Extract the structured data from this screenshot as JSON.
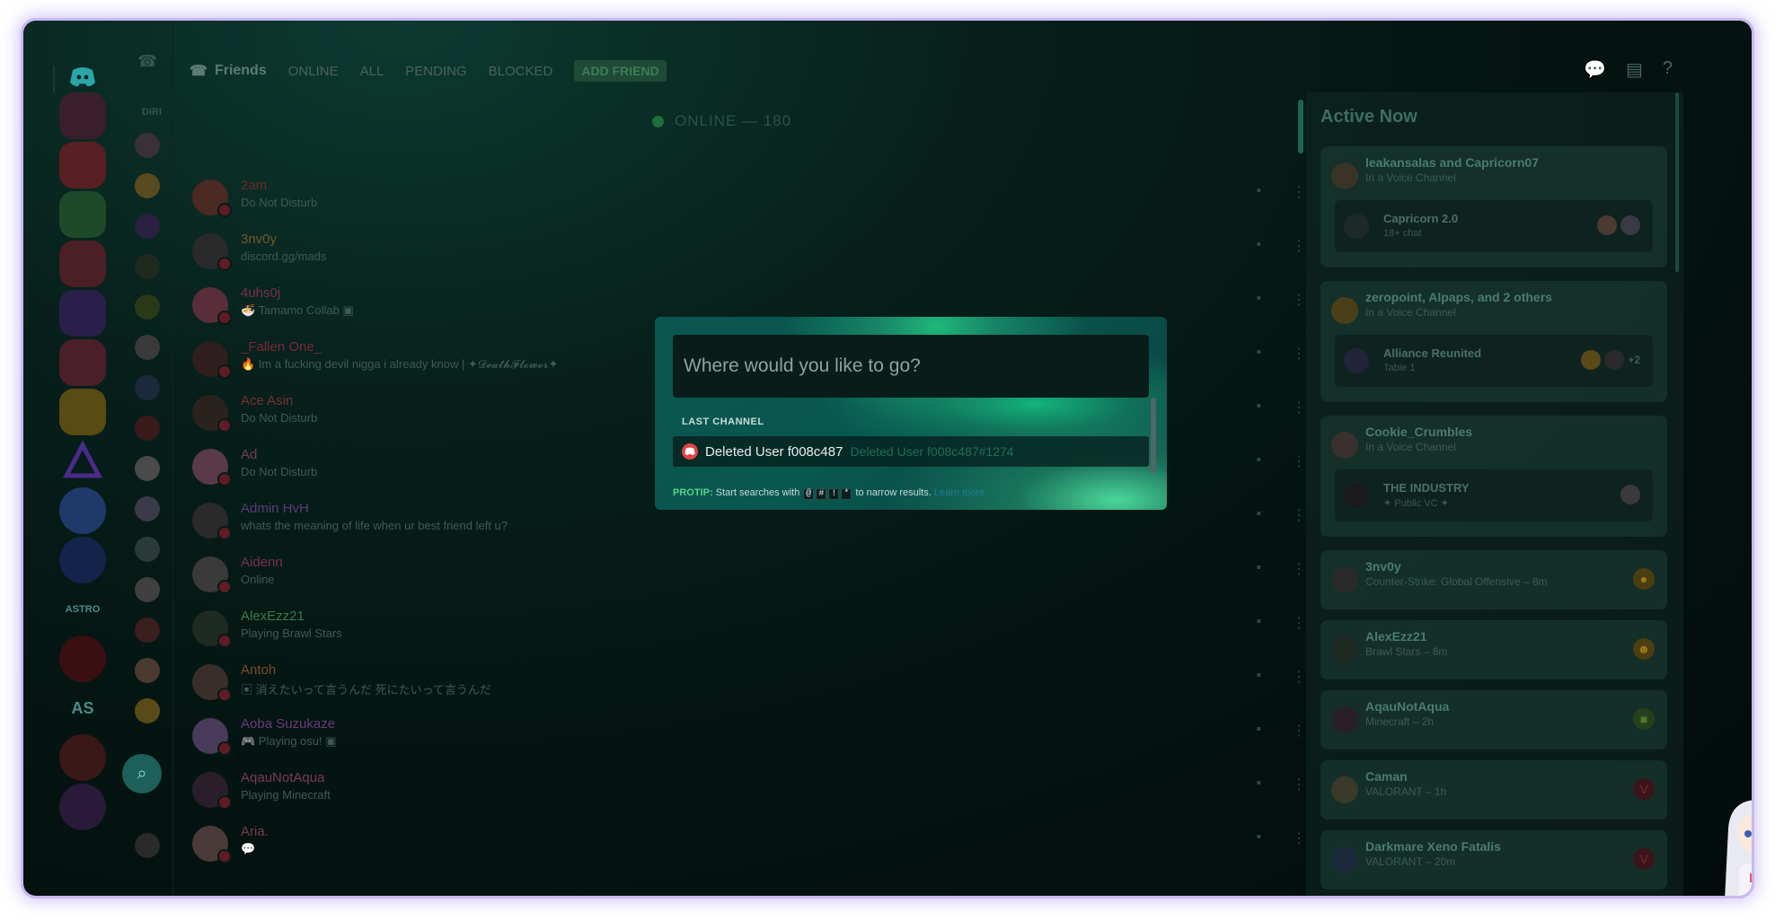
{
  "topbar": {
    "friends": "Friends",
    "tabs": [
      "ONLINE",
      "ALL",
      "PENDING",
      "BLOCKED"
    ],
    "add_friend": "ADD FRIEND"
  },
  "sidebar": {
    "dm_header": "DIRI",
    "guild_texts": [
      "ASTRO",
      "AS"
    ]
  },
  "friends": {
    "online_header": "ONLINE — 180",
    "rows": [
      {
        "name": "2am",
        "status": "Do Not Disturb",
        "color": "#6b2a2a",
        "avatar": "#4a2a22"
      },
      {
        "name": "3nv0y",
        "status": "discord.gg/mads",
        "color": "#6e5a2a",
        "avatar": "#2a2a2a"
      },
      {
        "name": "4uhs0j",
        "status": "🍜 Tamamo Collab ▣",
        "color": "#7a2f4a",
        "avatar": "#5a2d3a"
      },
      {
        "name": "_Fallen One_",
        "status": "🔥 Im a fucking devil nigga i already know | ✦𝓓𝓮𝓪𝓽𝓱𝓕𝓵𝓸𝔀𝓮𝓻✦",
        "color": "#7a2a35",
        "avatar": "#2f1e1e"
      },
      {
        "name": "Ace Asin",
        "status": "Do Not Disturb",
        "color": "#7a2f2f",
        "avatar": "#2a221e"
      },
      {
        "name": "Ad",
        "status": "Do Not Disturb",
        "color": "#7a3a5a",
        "avatar": "#5a3a48"
      },
      {
        "name": "Admin HvH",
        "status": "whats the meaning of life when ur best friend left u?",
        "color": "#5a3a7a",
        "avatar": "#2a2a2a"
      },
      {
        "name": "Aidenn",
        "status": "Online",
        "color": "#7a2f5a",
        "avatar": "#3a3a3a"
      },
      {
        "name": "AlexEzz21",
        "status": "Playing Brawl Stars",
        "color": "#3a7a4a",
        "avatar": "#1e2a22"
      },
      {
        "name": "Antoh",
        "status": "▣ 消えたいって言うんだ 死にたいって言うんだ",
        "color": "#7a4a2a",
        "avatar": "#3a2e2a"
      },
      {
        "name": "Aoba Suzukaze",
        "status": "🎮 Playing osu! ▣",
        "color": "#6a3a7a",
        "avatar": "#4a3a5a"
      },
      {
        "name": "AqauNotAqua",
        "status": "Playing Minecraft",
        "color": "#7a3a5a",
        "avatar": "#2a1e2a"
      },
      {
        "name": "Aria.",
        "status": "💬",
        "color": "#7a3a4a",
        "avatar": "#4a3a3a"
      }
    ]
  },
  "active_now": {
    "title": "Active Now",
    "cards": [
      {
        "name": "leakansalas and Capricorn07",
        "sub": "In a Voice Channel",
        "inner_name": "Capricorn 2.0",
        "inner_sub": "18+ chat",
        "extra": ""
      },
      {
        "name": "zeropoint, Alpaps, and 2 others",
        "sub": "In a Voice Channel",
        "inner_name": "Alliance Reunited",
        "inner_sub": "Table 1",
        "extra": "+2"
      },
      {
        "name": "Cookie_Crumbles",
        "sub": "In a Voice Channel",
        "inner_name": "THE INDUSTRY",
        "inner_sub": "✦ Public VC ✦",
        "extra": ""
      }
    ],
    "games": [
      {
        "name": "3nv0y",
        "sub": "Counter-Strike: Global Offensive – 8m"
      },
      {
        "name": "AlexEzz21",
        "sub": "Brawl Stars – 8m"
      },
      {
        "name": "AqauNotAqua",
        "sub": "Minecraft – 2h"
      },
      {
        "name": "Caman",
        "sub": "VALORANT – 1h"
      },
      {
        "name": "Darkmare Xeno Fatalis",
        "sub": "VALORANT – 20m"
      }
    ]
  },
  "quick_switcher": {
    "placeholder": "Where would you like to go?",
    "section": "LAST CHANNEL",
    "item_name": "Deleted User f008c487",
    "item_tag": "Deleted User f008c487#1274",
    "tip_label": "PROTIP:",
    "tip_text1": "Start searches with",
    "tip_keys": [
      "@",
      "#",
      "!",
      "*"
    ],
    "tip_text2": "to narrow results.",
    "tip_link": "Learn more"
  },
  "colors": {
    "accent": "#1fb87a",
    "danger": "#e04545",
    "protip": "#54d38a"
  }
}
